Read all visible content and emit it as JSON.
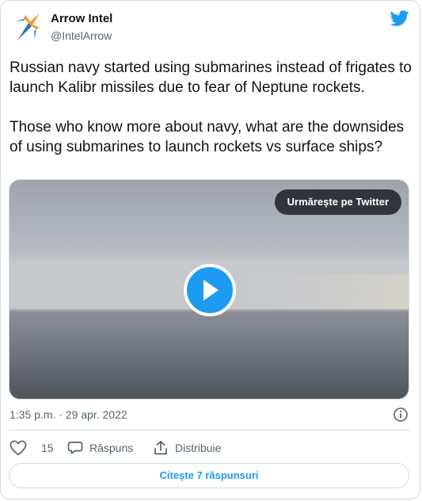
{
  "author": {
    "name": "Arrow Intel",
    "handle": "@IntelArrow"
  },
  "tweet": {
    "text": "Russian navy started using submarines instead of frigates to launch Kalibr missiles due to fear of Neptune rockets.\n\nThose who know more about navy, what are the downsides of using submarines to launch rockets vs surface ships?"
  },
  "media": {
    "watch_label": "Urmărește pe Twitter",
    "play_icon": "play-icon"
  },
  "meta": {
    "timestamp": "1:35 p.m. · 29 apr. 2022"
  },
  "actions": {
    "like_count": "15",
    "reply_label": "Răspuns",
    "share_label": "Distribuie"
  },
  "read_replies_label": "Citește 7 răspunsuri",
  "colors": {
    "accent": "#1d9bf0",
    "text": "#0f1419",
    "secondary": "#536471",
    "border": "#cfd9de"
  }
}
